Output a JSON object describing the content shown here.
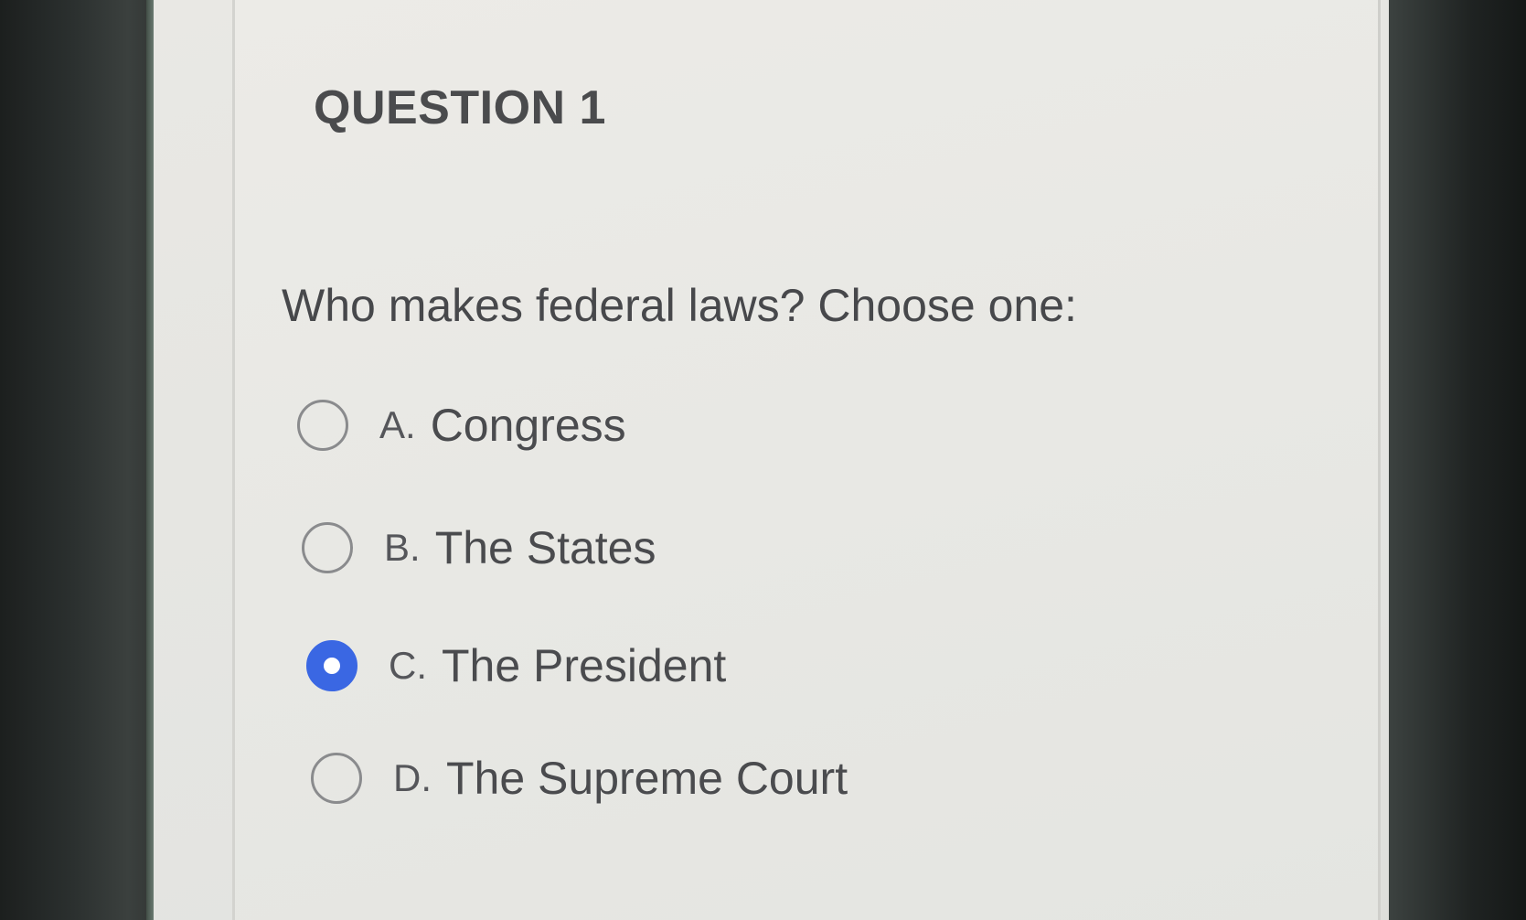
{
  "question": {
    "title": "QUESTION 1",
    "prompt": "Who makes federal laws? Choose one:"
  },
  "options": [
    {
      "letter": "A.",
      "label": "Congress",
      "selected": false
    },
    {
      "letter": "B.",
      "label": "The States",
      "selected": false
    },
    {
      "letter": "C.",
      "label": "The President",
      "selected": true
    },
    {
      "letter": "D.",
      "label": "The Supreme Court",
      "selected": false
    }
  ],
  "colors": {
    "radio_selected": "#3a67e3",
    "radio_border": "#8a8b8d",
    "text": "#4a4b4e",
    "background": "#e8e8e4"
  },
  "icons": {
    "radio_unselected": "radio-unchecked-icon",
    "radio_selected": "radio-checked-icon"
  }
}
